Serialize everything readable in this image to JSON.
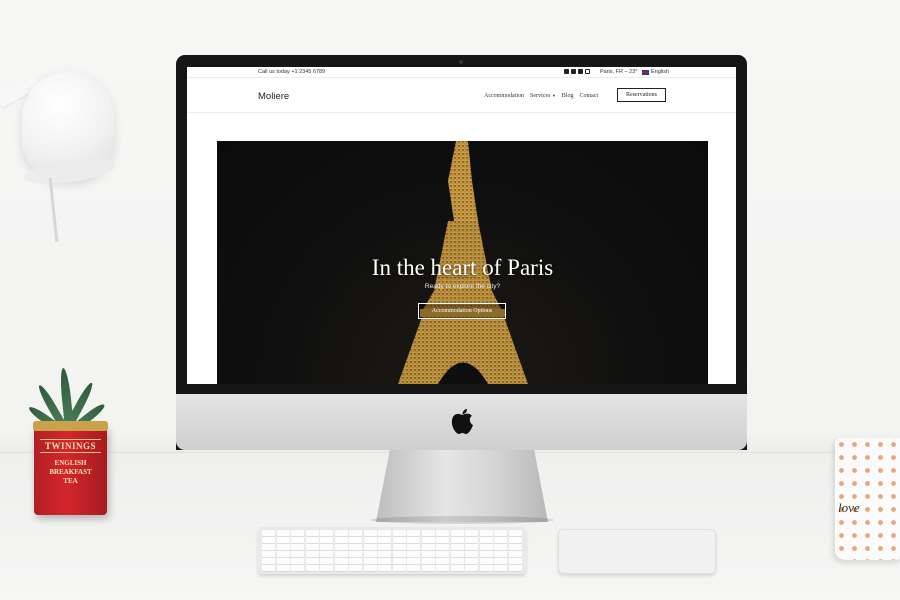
{
  "topbar": {
    "phone": "Call us today +1 2345 6789",
    "weather": "Paris, FR – 23°",
    "language": "English",
    "socials": [
      "facebook-icon",
      "twitter-icon",
      "instagram-icon",
      "email-icon"
    ]
  },
  "navbar": {
    "brand": "Moliere",
    "items": [
      {
        "label": "Accommodation"
      },
      {
        "label": "Services"
      },
      {
        "label": "Blog"
      },
      {
        "label": "Contact"
      }
    ],
    "reservations": "Reservations"
  },
  "hero": {
    "title": "In the heart of Paris",
    "subtitle": "Ready to explore the city?",
    "button": "Accommodation Options"
  },
  "props": {
    "tin_brand": "TWININGS",
    "tin_line1": "ENGLISH",
    "tin_line2": "BREAKFAST",
    "tin_line3": "TEA",
    "mug_word": "love"
  },
  "colors": {
    "hero_bg": "#0b0b0b",
    "tower_gold": "#c98f2a",
    "tin_red": "#d3262c"
  }
}
